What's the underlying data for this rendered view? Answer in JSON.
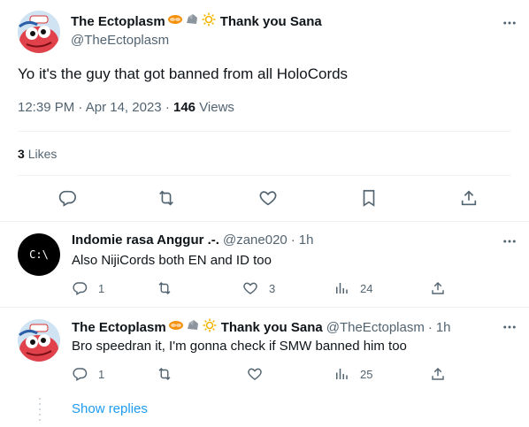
{
  "main_tweet": {
    "display_name": "The Ectoplasm",
    "suffix": "Thank you Sana",
    "handle": "@TheEctoplasm",
    "text": "Yo it's the guy that got banned from all HoloCords",
    "time": "12:39 PM",
    "separator": "·",
    "date": "Apr 14, 2023",
    "separator2": "·",
    "views_count": "146",
    "views_label": "Views",
    "likes_count": "3",
    "likes_label": "Likes"
  },
  "replies": [
    {
      "display_name": "Indomie rasa Anggur .-.",
      "handle": "@zane020",
      "dot": "·",
      "time": "1h",
      "text": "Also NijiCords both EN and ID too",
      "avatar_text": "C:\\",
      "replies": "1",
      "retweets": "",
      "likes": "3",
      "views": "24"
    },
    {
      "display_name": "The Ectoplasm",
      "suffix": "Thank you Sana",
      "handle": "@TheEctoplasm",
      "dot": "·",
      "time": "1h",
      "text": "Bro speedran it, I'm gonna check if SMW banned him too",
      "replies": "1",
      "retweets": "",
      "likes": "",
      "views": "25"
    }
  ],
  "show_replies": "Show replies",
  "colors": {
    "text": "#0f1419",
    "secondary": "#536471",
    "link": "#1d9bf0",
    "divider": "#eff3f4"
  },
  "icons": [
    "more-icon",
    "reply-icon",
    "retweet-icon",
    "like-icon",
    "bookmark-icon",
    "share-icon",
    "views-icon",
    "pretzel-emoji",
    "rock-emoji",
    "sun-emoji"
  ]
}
